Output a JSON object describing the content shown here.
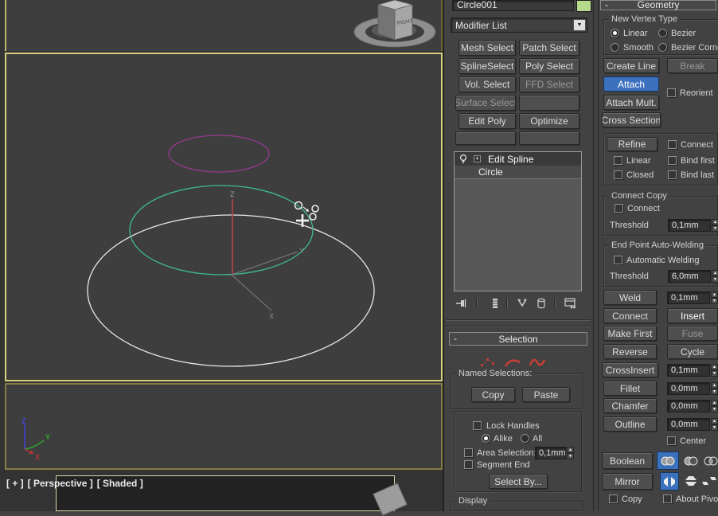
{
  "colors": {
    "accent_blue": "#3b70bc",
    "active_viewport_border": "#d6cd7d",
    "inactive_viewport_border": "#877c45",
    "object_color_swatch": "#b6da8c",
    "subobject_icon_red": "#c23e36",
    "spline_white": "#e8e8e8",
    "spline_selected_green": "#3fbb8f",
    "spline_purple": "#983a90",
    "axis_red": "#b64545"
  },
  "viewport": {
    "viewcube_face_label": "RIGHT",
    "gizmo_axis_labels": {
      "x": "X",
      "y": "Y",
      "z": "Z"
    },
    "world_axis_labels": {
      "x": "X",
      "y": "Y",
      "z": "Z"
    },
    "view_label_menus": {
      "general": "[ + ]",
      "pov": "[ Perspective ]",
      "shading": "[ Shaded ]"
    }
  },
  "command_panel": {
    "object_name": "Circle001",
    "modifier_list_label": "Modifier List",
    "modifier_set_buttons": [
      "Mesh Select",
      "Patch Select",
      "SplineSelect",
      "Poly Select",
      "Vol. Select",
      "FFD Select",
      "Surface Select",
      "",
      "Edit Poly",
      "Optimize",
      "",
      ""
    ],
    "modifier_stack": {
      "items": [
        "Edit Spline",
        "Circle"
      ],
      "selected": "Edit Spline",
      "toolbar_icons": [
        "pin-stack",
        "show-end-result",
        "make-unique",
        "remove-modifier",
        "configure-modifier-sets"
      ]
    },
    "selection_rollout": {
      "title": "Selection",
      "subobject_buttons": [
        "vertex",
        "segment",
        "spline"
      ],
      "named_selections_label": "Named Selections:",
      "copy_button": "Copy",
      "paste_button": "Paste",
      "lock_handles_label": "Lock Handles",
      "alike_label": "Alike",
      "all_label": "All",
      "area_selection_label": "Area Selection:",
      "area_selection_value": "0,1mm",
      "segment_end_label": "Segment End",
      "select_by_button": "Select By...",
      "display_group_label": "Display"
    },
    "geometry_rollout": {
      "title": "Geometry",
      "new_vertex_type_label": "New Vertex Type",
      "linear_radio": "Linear",
      "bezier_radio": "Bezier",
      "smooth_radio": "Smooth",
      "bezier_corner_radio": "Bezier Corner",
      "create_line_button": "Create Line",
      "break_button": "Break",
      "attach_button": "Attach",
      "reorient_label": "Reorient",
      "attach_mult_button": "Attach Mult.",
      "cross_section_button": "Cross Section",
      "refine_button": "Refine",
      "connect_checkbox": "Connect",
      "linear_checkbox": "Linear",
      "bind_first_checkbox": "Bind first",
      "closed_checkbox": "Closed",
      "bind_last_checkbox": "Bind last",
      "connect_copy_label": "Connect Copy",
      "connect_copy_checkbox": "Connect",
      "threshold_label": "Threshold",
      "connect_copy_threshold": "0,1mm",
      "end_point_label": "End Point Auto-Welding",
      "automatic_welding_checkbox": "Automatic Welding",
      "weld_threshold": "6,0mm",
      "weld_button": "Weld",
      "weld_value": "0,1mm",
      "connect_button": "Connect",
      "insert_button": "Insert",
      "make_first_button": "Make First",
      "fuse_button": "Fuse",
      "reverse_button": "Reverse",
      "cycle_button": "Cycle",
      "crossinsert_button": "CrossInsert",
      "crossinsert_value": "0,1mm",
      "fillet_button": "Fillet",
      "fillet_value": "0,0mm",
      "chamfer_button": "Chamfer",
      "chamfer_value": "0,0mm",
      "outline_button": "Outline",
      "outline_value": "0,0mm",
      "center_checkbox": "Center",
      "boolean_button": "Boolean",
      "mirror_button": "Mirror",
      "copy_checkbox": "Copy",
      "about_pivot_checkbox": "About Pivot"
    }
  }
}
